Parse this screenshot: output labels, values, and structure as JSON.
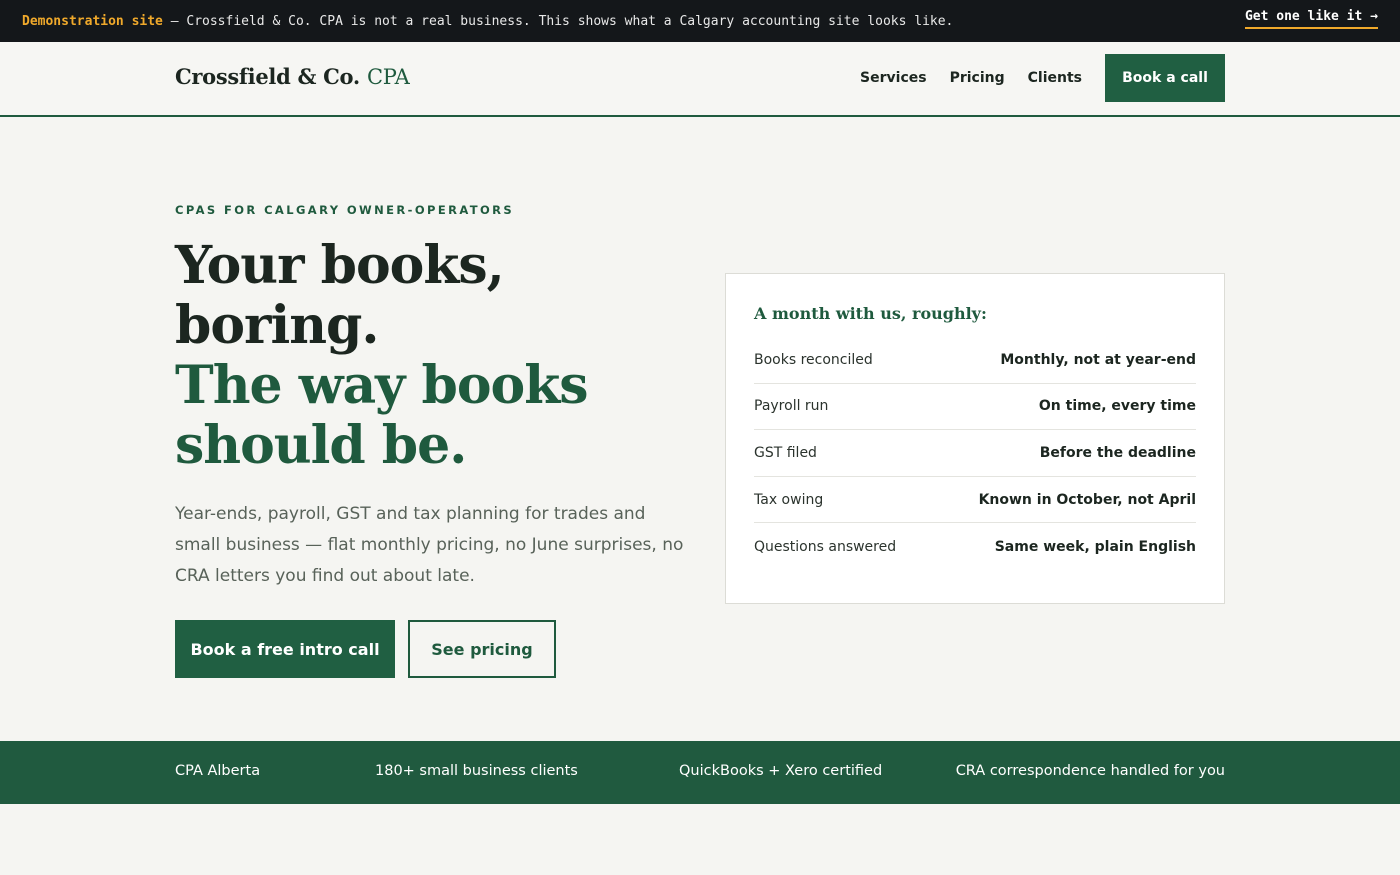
{
  "banner": {
    "tag": "Demonstration site",
    "message": " — Crossfield & Co. CPA is not a real business. This shows what a Calgary accounting site looks like.",
    "cta": "Get one like it →"
  },
  "header": {
    "logo_main": "Crossfield & Co.",
    "logo_accent": "CPA",
    "nav": [
      "Services",
      "Pricing",
      "Clients"
    ],
    "cta": "Book a call"
  },
  "hero": {
    "eyebrow": "CPAS FOR CALGARY OWNER-OPERATORS",
    "headline_line1": "Your books, boring.",
    "headline_line2": "The way books should be.",
    "lede": "Year-ends, payroll, GST and tax planning for trades and small business — flat monthly pricing, no June surprises, no CRA letters you find out about late.",
    "primary_cta": "Book a free intro call",
    "secondary_cta": "See pricing"
  },
  "card": {
    "title": "A month with us, roughly:",
    "rows": [
      {
        "label": "Books reconciled",
        "value": "Monthly, not at year-end"
      },
      {
        "label": "Payroll run",
        "value": "On time, every time"
      },
      {
        "label": "GST filed",
        "value": "Before the deadline"
      },
      {
        "label": "Tax owing",
        "value": "Known in October, not April"
      },
      {
        "label": "Questions answered",
        "value": "Same week, plain English"
      }
    ]
  },
  "trust_strip": [
    "CPA Alberta",
    "180+ small business clients",
    "QuickBooks + Xero certified",
    "CRA correspondence handled for you"
  ],
  "colors": {
    "brand_green": "#205f42",
    "accent_amber": "#f0a92b",
    "banner_bg": "#14171a",
    "page_bg": "#f5f5f2"
  }
}
